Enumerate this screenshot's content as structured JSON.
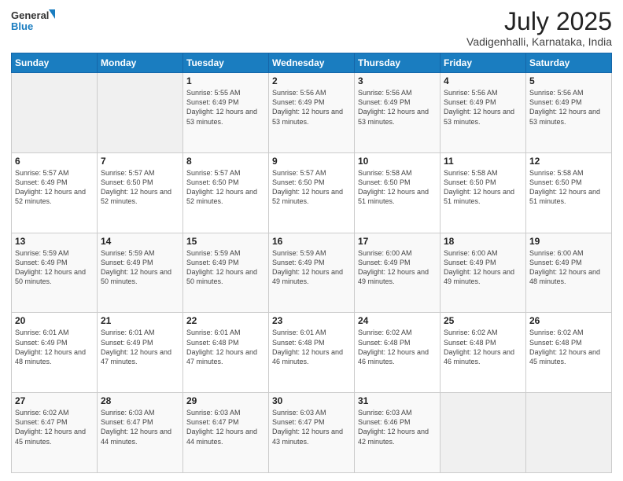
{
  "header": {
    "logo_line1": "General",
    "logo_line2": "Blue",
    "title": "July 2025",
    "subtitle": "Vadigenhalli, Karnataka, India"
  },
  "days_of_week": [
    "Sunday",
    "Monday",
    "Tuesday",
    "Wednesday",
    "Thursday",
    "Friday",
    "Saturday"
  ],
  "weeks": [
    [
      {
        "day": "",
        "info": ""
      },
      {
        "day": "",
        "info": ""
      },
      {
        "day": "1",
        "info": "Sunrise: 5:55 AM\nSunset: 6:49 PM\nDaylight: 12 hours and 53 minutes."
      },
      {
        "day": "2",
        "info": "Sunrise: 5:56 AM\nSunset: 6:49 PM\nDaylight: 12 hours and 53 minutes."
      },
      {
        "day": "3",
        "info": "Sunrise: 5:56 AM\nSunset: 6:49 PM\nDaylight: 12 hours and 53 minutes."
      },
      {
        "day": "4",
        "info": "Sunrise: 5:56 AM\nSunset: 6:49 PM\nDaylight: 12 hours and 53 minutes."
      },
      {
        "day": "5",
        "info": "Sunrise: 5:56 AM\nSunset: 6:49 PM\nDaylight: 12 hours and 53 minutes."
      }
    ],
    [
      {
        "day": "6",
        "info": "Sunrise: 5:57 AM\nSunset: 6:49 PM\nDaylight: 12 hours and 52 minutes."
      },
      {
        "day": "7",
        "info": "Sunrise: 5:57 AM\nSunset: 6:50 PM\nDaylight: 12 hours and 52 minutes."
      },
      {
        "day": "8",
        "info": "Sunrise: 5:57 AM\nSunset: 6:50 PM\nDaylight: 12 hours and 52 minutes."
      },
      {
        "day": "9",
        "info": "Sunrise: 5:57 AM\nSunset: 6:50 PM\nDaylight: 12 hours and 52 minutes."
      },
      {
        "day": "10",
        "info": "Sunrise: 5:58 AM\nSunset: 6:50 PM\nDaylight: 12 hours and 51 minutes."
      },
      {
        "day": "11",
        "info": "Sunrise: 5:58 AM\nSunset: 6:50 PM\nDaylight: 12 hours and 51 minutes."
      },
      {
        "day": "12",
        "info": "Sunrise: 5:58 AM\nSunset: 6:50 PM\nDaylight: 12 hours and 51 minutes."
      }
    ],
    [
      {
        "day": "13",
        "info": "Sunrise: 5:59 AM\nSunset: 6:49 PM\nDaylight: 12 hours and 50 minutes."
      },
      {
        "day": "14",
        "info": "Sunrise: 5:59 AM\nSunset: 6:49 PM\nDaylight: 12 hours and 50 minutes."
      },
      {
        "day": "15",
        "info": "Sunrise: 5:59 AM\nSunset: 6:49 PM\nDaylight: 12 hours and 50 minutes."
      },
      {
        "day": "16",
        "info": "Sunrise: 5:59 AM\nSunset: 6:49 PM\nDaylight: 12 hours and 49 minutes."
      },
      {
        "day": "17",
        "info": "Sunrise: 6:00 AM\nSunset: 6:49 PM\nDaylight: 12 hours and 49 minutes."
      },
      {
        "day": "18",
        "info": "Sunrise: 6:00 AM\nSunset: 6:49 PM\nDaylight: 12 hours and 49 minutes."
      },
      {
        "day": "19",
        "info": "Sunrise: 6:00 AM\nSunset: 6:49 PM\nDaylight: 12 hours and 48 minutes."
      }
    ],
    [
      {
        "day": "20",
        "info": "Sunrise: 6:01 AM\nSunset: 6:49 PM\nDaylight: 12 hours and 48 minutes."
      },
      {
        "day": "21",
        "info": "Sunrise: 6:01 AM\nSunset: 6:49 PM\nDaylight: 12 hours and 47 minutes."
      },
      {
        "day": "22",
        "info": "Sunrise: 6:01 AM\nSunset: 6:48 PM\nDaylight: 12 hours and 47 minutes."
      },
      {
        "day": "23",
        "info": "Sunrise: 6:01 AM\nSunset: 6:48 PM\nDaylight: 12 hours and 46 minutes."
      },
      {
        "day": "24",
        "info": "Sunrise: 6:02 AM\nSunset: 6:48 PM\nDaylight: 12 hours and 46 minutes."
      },
      {
        "day": "25",
        "info": "Sunrise: 6:02 AM\nSunset: 6:48 PM\nDaylight: 12 hours and 46 minutes."
      },
      {
        "day": "26",
        "info": "Sunrise: 6:02 AM\nSunset: 6:48 PM\nDaylight: 12 hours and 45 minutes."
      }
    ],
    [
      {
        "day": "27",
        "info": "Sunrise: 6:02 AM\nSunset: 6:47 PM\nDaylight: 12 hours and 45 minutes."
      },
      {
        "day": "28",
        "info": "Sunrise: 6:03 AM\nSunset: 6:47 PM\nDaylight: 12 hours and 44 minutes."
      },
      {
        "day": "29",
        "info": "Sunrise: 6:03 AM\nSunset: 6:47 PM\nDaylight: 12 hours and 44 minutes."
      },
      {
        "day": "30",
        "info": "Sunrise: 6:03 AM\nSunset: 6:47 PM\nDaylight: 12 hours and 43 minutes."
      },
      {
        "day": "31",
        "info": "Sunrise: 6:03 AM\nSunset: 6:46 PM\nDaylight: 12 hours and 42 minutes."
      },
      {
        "day": "",
        "info": ""
      },
      {
        "day": "",
        "info": ""
      }
    ]
  ]
}
